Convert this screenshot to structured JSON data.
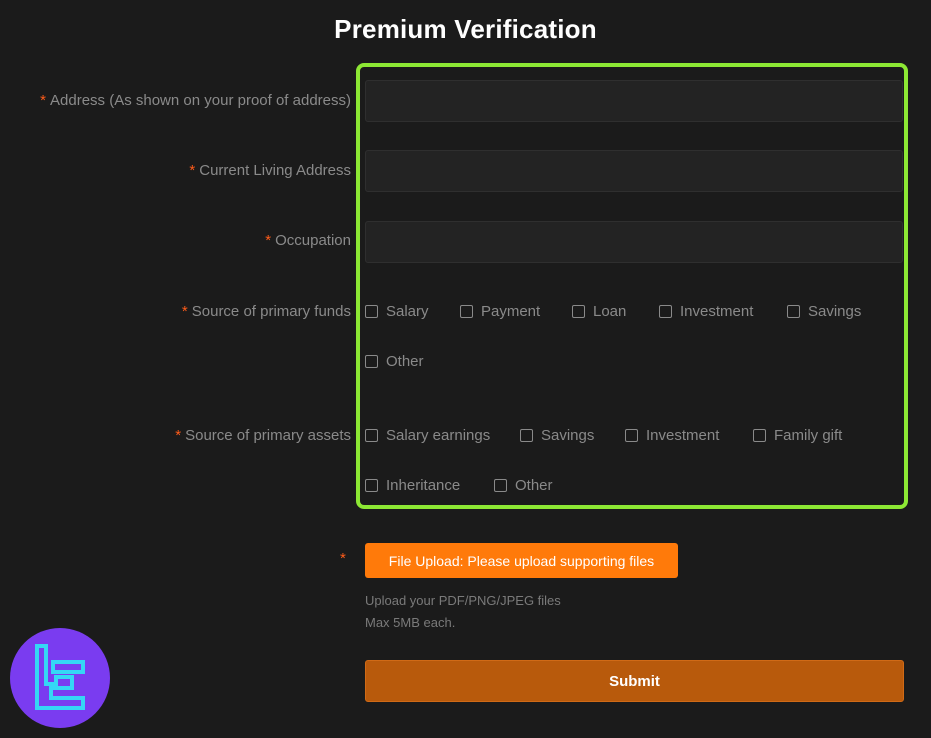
{
  "page": {
    "title": "Premium Verification"
  },
  "form": {
    "required_marker": "*",
    "fields": {
      "address_label": "Address (As shown on your proof of address)",
      "address_value": "",
      "living_address_label": "Current Living Address",
      "living_address_value": "",
      "occupation_label": "Occupation",
      "occupation_value": ""
    },
    "primary_funds": {
      "label": "Source of primary funds",
      "options": [
        "Salary",
        "Payment",
        "Loan",
        "Investment",
        "Savings",
        "Other"
      ]
    },
    "primary_assets": {
      "label": "Source of primary assets",
      "options": [
        "Salary earnings",
        "Savings",
        "Investment",
        "Family gift",
        "Inheritance",
        "Other"
      ]
    },
    "upload": {
      "button_label": "File Upload: Please upload supporting files",
      "hint_line1": "Upload your PDF/PNG/JPEG files",
      "hint_line2": "Max 5MB each."
    },
    "submit_label": "Submit"
  },
  "colors": {
    "background": "#1b1b1b",
    "highlight_border": "#8de834",
    "required": "#ff5c1a",
    "upload_button": "#ff7a0a",
    "submit_button": "#b85a0c",
    "logo_bg": "#7a3cf0",
    "logo_fg": "#35d6f5"
  },
  "icons": {
    "logo": "tc-logo-icon"
  }
}
